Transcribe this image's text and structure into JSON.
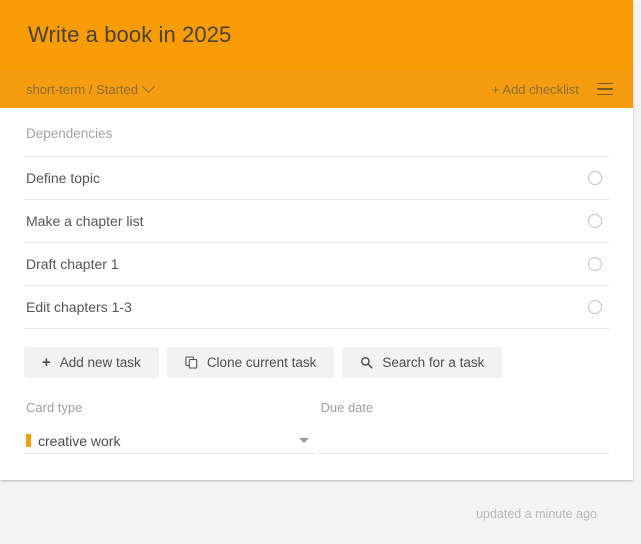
{
  "header": {
    "title": "Write a book in 2025",
    "breadcrumb": "short-term / Started",
    "breadcrumb_chevron": "chevron-down-icon",
    "add_checklist_label": "+ Add checklist",
    "menu_icon": "hamburger-menu-icon",
    "bg_color": "#f99d07",
    "subbar_color": "#f59c10",
    "title_color": "#4c4235"
  },
  "dependencies": {
    "section_label": "Dependencies",
    "tasks": [
      {
        "label": "Define topic",
        "checked": false
      },
      {
        "label": "Make a chapter list",
        "checked": false
      },
      {
        "label": "Draft chapter 1",
        "checked": false
      },
      {
        "label": "Edit chapters 1-3",
        "checked": false
      }
    ]
  },
  "actions": {
    "add_task": {
      "label": "Add new task",
      "icon": "plus-icon"
    },
    "clone_task": {
      "label": "Clone current task",
      "icon": "copy-icon"
    },
    "search_task": {
      "label": "Search for a task",
      "icon": "search-icon"
    }
  },
  "fields": {
    "card_type": {
      "label": "Card type",
      "value": "creative work",
      "swatch_color": "#f5a10c",
      "caret_icon": "caret-down-icon"
    },
    "due_date": {
      "label": "Due date",
      "value": "",
      "placeholder": ""
    }
  },
  "footer": {
    "updated_text": "updated a minute ago"
  }
}
